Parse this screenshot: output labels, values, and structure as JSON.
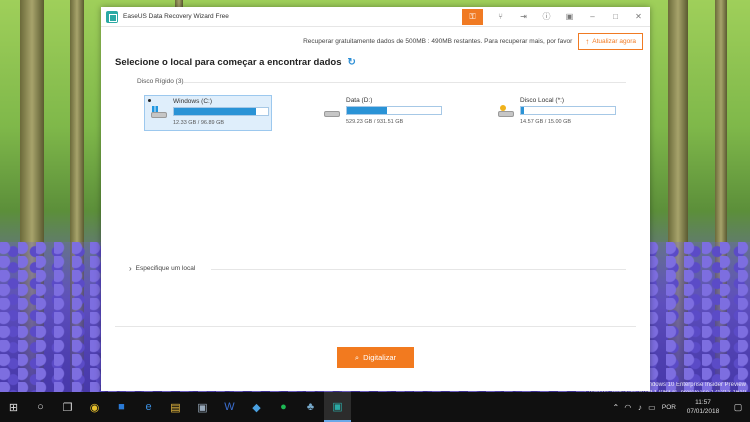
{
  "window": {
    "title": "EaseUS Data Recovery Wizard Free"
  },
  "promo": {
    "text": "Recuperar gratuitamente dados de 500MB :  490MB restantes. Para recuperar mais, por favor",
    "upgrade_label": "Atualizar agora"
  },
  "main": {
    "heading": "Selecione o local para começar a encontrar dados",
    "section_label": "Disco Rígido (3)",
    "drives": [
      {
        "name": "Windows (C:)",
        "size": "12.33 GB / 96.89 GB",
        "used_fraction": 0.87,
        "icon": "windows-drive-icon"
      },
      {
        "name": "Data (D:)",
        "size": "529.23 GB / 931.51 GB",
        "used_fraction": 0.43,
        "icon": "hdd-icon"
      },
      {
        "name": "Disco Local (*:)",
        "size": "14.57 GB / 15.00 GB",
        "used_fraction": 0.03,
        "icon": "usb-drive-icon"
      }
    ],
    "specify_label": "Especifique um local",
    "scan_label": "Digitalizar"
  },
  "desktop": {
    "watermark_line1": "Windows 10 Enterprise Insider Preview",
    "watermark_line2": "Cópia de avaliação. Build 17063.rs_prerelease.171213-1610"
  },
  "taskbar": {
    "language": "POR",
    "time": "11:57",
    "date": "07/01/2018"
  },
  "colors": {
    "accent": "#f27a1f",
    "bar_fill": "#2a93d6",
    "selected_bg": "#dfeefb"
  }
}
